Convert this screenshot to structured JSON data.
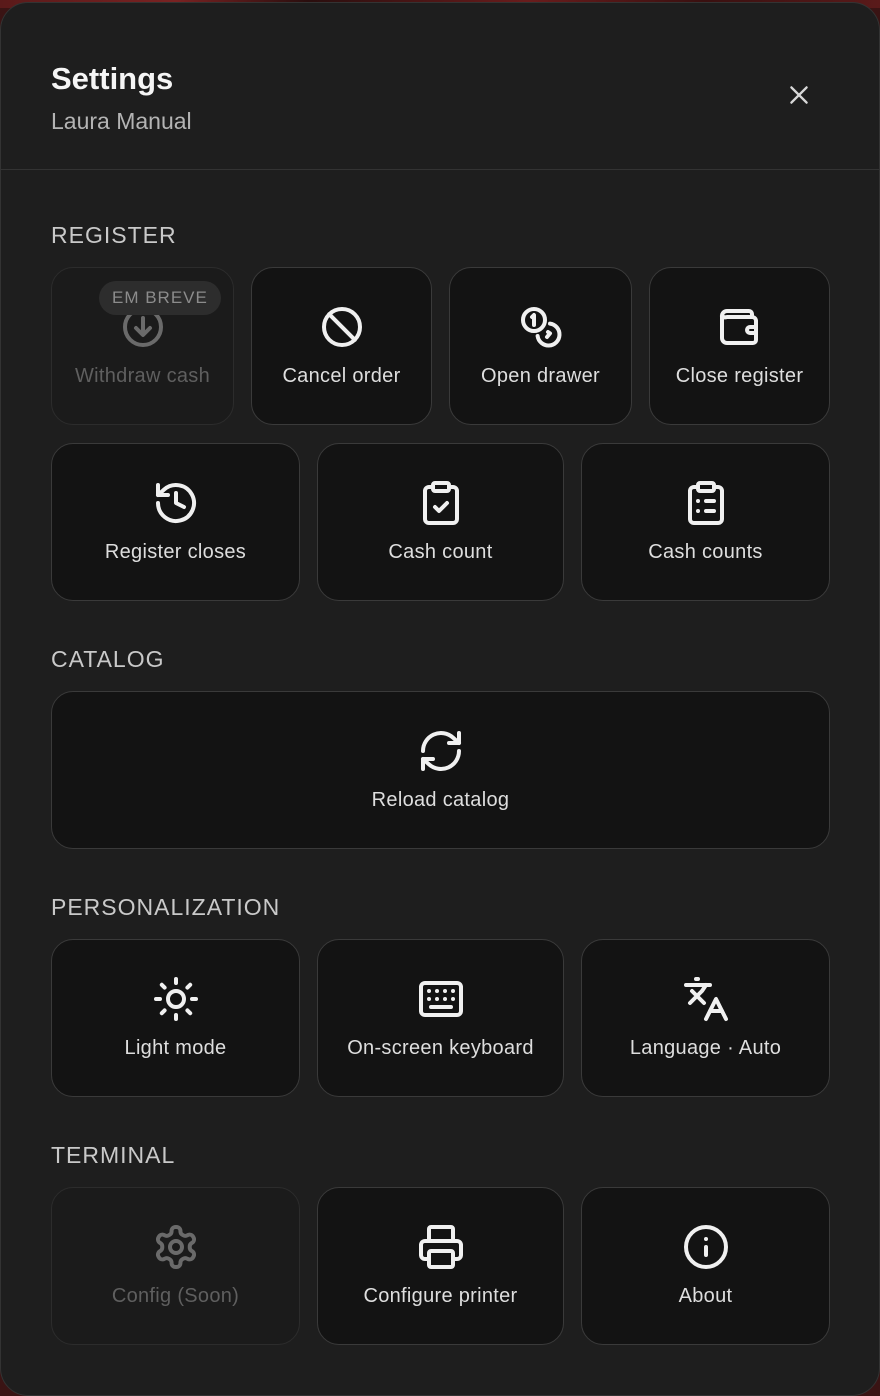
{
  "header": {
    "title": "Settings",
    "user_name": "Laura Manual"
  },
  "sections": {
    "register": {
      "title": "REGISTER",
      "items": [
        {
          "label": "Withdraw cash",
          "icon": "download-circle-icon",
          "disabled": true,
          "badge": "EM BREVE"
        },
        {
          "label": "Cancel order",
          "icon": "ban-icon"
        },
        {
          "label": "Open drawer",
          "icon": "coins-icon"
        },
        {
          "label": "Close register",
          "icon": "wallet-icon"
        },
        {
          "label": "Register closes",
          "icon": "history-icon"
        },
        {
          "label": "Cash count",
          "icon": "clipboard-check-icon"
        },
        {
          "label": "Cash counts",
          "icon": "clipboard-list-icon"
        }
      ]
    },
    "catalog": {
      "title": "CATALOG",
      "items": [
        {
          "label": "Reload catalog",
          "icon": "refresh-icon"
        }
      ]
    },
    "personalization": {
      "title": "PERSONALIZATION",
      "items": [
        {
          "label": "Light mode",
          "icon": "sun-icon"
        },
        {
          "label": "On-screen keyboard",
          "icon": "keyboard-icon"
        },
        {
          "label": "Language · Auto",
          "icon": "languages-icon"
        }
      ]
    },
    "terminal": {
      "title": "TERMINAL",
      "items": [
        {
          "label": "Config (Soon)",
          "icon": "gear-icon",
          "disabled": true
        },
        {
          "label": "Configure printer",
          "icon": "printer-icon"
        },
        {
          "label": "About",
          "icon": "info-icon"
        }
      ]
    }
  },
  "colors": {
    "panel_bg": "#1e1e1e",
    "tile_bg": "#131313",
    "tile_border": "#3a3a3a",
    "text_primary": "#f2f2f2",
    "text_muted": "#b4b4b4",
    "disabled_text": "#5f5f5f"
  }
}
